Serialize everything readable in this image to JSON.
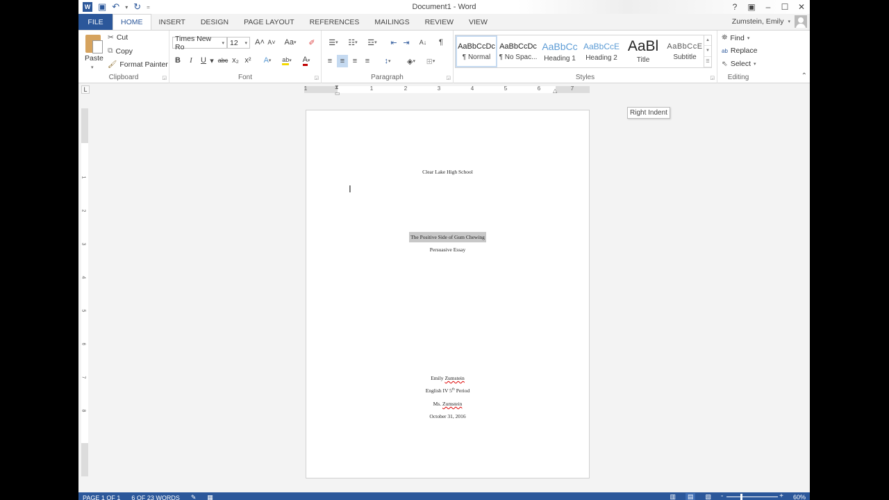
{
  "window": {
    "title": "Document1 - Word",
    "controls": {
      "help": "?",
      "ribbon_display": "▣",
      "minimize": "–",
      "maximize": "☐",
      "close": "✕"
    },
    "user": "Zumstein, Emily"
  },
  "quick_access": {
    "app_icon": "W",
    "save": "💾",
    "undo": "↶",
    "undo_dd": "▾",
    "redo": "↻",
    "customize": "="
  },
  "tabs": [
    {
      "label": "FILE"
    },
    {
      "label": "HOME",
      "active": true
    },
    {
      "label": "INSERT"
    },
    {
      "label": "DESIGN"
    },
    {
      "label": "PAGE LAYOUT"
    },
    {
      "label": "REFERENCES"
    },
    {
      "label": "MAILINGS"
    },
    {
      "label": "REVIEW"
    },
    {
      "label": "VIEW"
    }
  ],
  "ribbon": {
    "clipboard": {
      "label": "Clipboard",
      "paste": "Paste",
      "cut": "Cut",
      "copy": "Copy",
      "format_painter": "Format Painter"
    },
    "font": {
      "label": "Font",
      "font_name": "Times New Ro",
      "font_size": "12",
      "grow": "A˄",
      "shrink": "A˅",
      "change_case": "Aa",
      "clear": "✐",
      "bold": "B",
      "italic": "I",
      "underline": "U",
      "strikethrough": "abc",
      "subscript": "x₂",
      "superscript": "x²",
      "text_effects": "A",
      "highlight": "ab",
      "font_color": "A"
    },
    "paragraph": {
      "label": "Paragraph",
      "bullets": "☰",
      "numbering": "☷",
      "multilevel": "☲",
      "decrease_indent": "⇤",
      "increase_indent": "⇥",
      "sort": "A↓",
      "show_marks": "¶",
      "align_left": "≡",
      "center": "≡",
      "align_right": "≡",
      "justify": "≡",
      "line_spacing": "↕",
      "shading": "◈",
      "borders": "⊞"
    },
    "styles": {
      "label": "Styles",
      "items": [
        {
          "sample": "AaBbCcDc",
          "name": "¶ Normal",
          "selected": true
        },
        {
          "sample": "AaBbCcDc",
          "name": "¶ No Spac..."
        },
        {
          "sample": "AaBbCc",
          "name": "Heading 1"
        },
        {
          "sample": "AaBbCcE",
          "name": "Heading 2"
        },
        {
          "sample": "AaBl",
          "name": "Title"
        },
        {
          "sample": "AaBbCcE",
          "name": "Subtitle"
        }
      ]
    },
    "editing": {
      "label": "Editing",
      "find": "Find",
      "replace": "Replace",
      "select": "Select"
    }
  },
  "ruler": {
    "corner": "L",
    "h_labels": [
      "1",
      "1",
      "2",
      "3",
      "4",
      "5",
      "6",
      "7"
    ],
    "v_labels": [
      "1",
      "2",
      "3",
      "4",
      "5",
      "6",
      "7",
      "8"
    ]
  },
  "tooltip": "Right Indent",
  "document": {
    "lines": [
      {
        "text": "Clear Lake High School"
      },
      {
        "text": "The Positive Side of Gum Chewing",
        "selected": true
      },
      {
        "text": "Persuasive Essay"
      },
      {
        "pre": "Emily ",
        "squiggle": "Zumstein",
        "post": ""
      },
      {
        "pre": "English IV 5",
        "sup": "th",
        "post": " Period"
      },
      {
        "pre": "Ms. ",
        "squiggle": "Zumstein",
        "post": ""
      },
      {
        "text": "October 31, 2016"
      }
    ]
  },
  "statusbar": {
    "page": "PAGE 1 OF 1",
    "words": "6 OF 23 WORDS",
    "proofing_icon": "✎",
    "macro_icon": "▦",
    "views": [
      "read-mode",
      "print-layout",
      "web-layout"
    ],
    "zoom": "60%",
    "zoom_value": 60
  },
  "colors": {
    "brand": "#2b579a",
    "selection": "#c8c8c8",
    "active_button": "#c5daf1"
  }
}
